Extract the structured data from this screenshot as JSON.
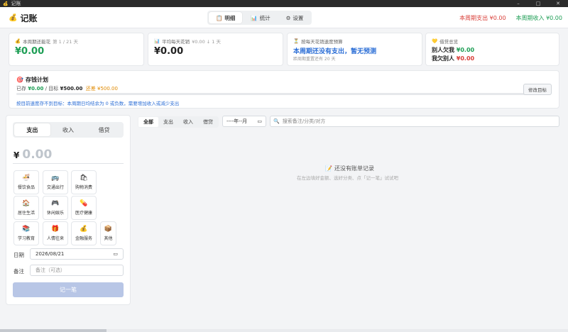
{
  "window": {
    "title": "记账",
    "minimize": "–",
    "maximize": "□",
    "close": "✕"
  },
  "app": {
    "icon": "💰",
    "title": "记账"
  },
  "nav": {
    "tabs": [
      {
        "icon": "📋",
        "label": "明细"
      },
      {
        "icon": "📊",
        "label": "统计"
      },
      {
        "icon": "⚙",
        "label": "设置"
      }
    ]
  },
  "period": {
    "expense": "本周期支出 ¥0.00",
    "income": "本周期收入 ¥0.00"
  },
  "stats": {
    "remaining": {
      "icon": "💰",
      "label": "本周期还能花",
      "sub": "第 1 / 21 天",
      "value": "¥0.00"
    },
    "daily": {
      "icon": "📊",
      "label": "平均每天花销",
      "sub": "¥0.00 ↓ 1 天",
      "value": "¥0.00"
    },
    "forecast": {
      "icon": "⏳",
      "label": "按每天花销速度预算",
      "value": "本周期还没有支出，暂无预测",
      "sub": "距周期重置还有 20 天"
    },
    "debt": {
      "icon": "💛",
      "label": "借贷总览",
      "owed_label": "别人欠我",
      "owed_value": "¥0.00",
      "owe_label": "我欠别人",
      "owe_value": "¥0.00"
    }
  },
  "plan": {
    "icon": "🎯",
    "title": "存钱计划",
    "saved_label": "已存",
    "saved_value": "¥0.00",
    "target_label": "/ 目标",
    "target_value": "¥500.00",
    "gap": "还差 ¥500.00",
    "progress": 0,
    "tip": "按目前速度存不到目标：本周期日均结余为 0 或负数，需要增加收入或减少支出",
    "edit_button": "修改目标"
  },
  "entry": {
    "types": [
      "支出",
      "收入",
      "借贷"
    ],
    "active_type": "支出",
    "currency": "¥",
    "amount": "0.00",
    "categories": [
      {
        "icon": "🍜",
        "label": "餐饮食品"
      },
      {
        "icon": "🚌",
        "label": "交通出行"
      },
      {
        "icon": "🛍",
        "label": "购物消费"
      },
      {
        "icon": "🏠",
        "label": "居住生活"
      },
      {
        "icon": "🎮",
        "label": "休闲娱乐"
      },
      {
        "icon": "💊",
        "label": "医疗健康"
      },
      {
        "icon": "📚",
        "label": "学习教育"
      },
      {
        "icon": "🎁",
        "label": "人情往来"
      },
      {
        "icon": "💰",
        "label": "金融服务"
      },
      {
        "icon": "📦",
        "label": "其他"
      }
    ],
    "date_label": "日期",
    "date_value": "2026/08/21",
    "note_label": "备注",
    "note_placeholder": "备注（可选）",
    "submit": "记一笔"
  },
  "list": {
    "filters": [
      "全部",
      "支出",
      "收入",
      "借贷"
    ],
    "active_filter": "全部",
    "month_placeholder": "----年--月",
    "search_placeholder": "搜索备注/分类/对方",
    "empty_icon": "📝",
    "empty_title": "还没有账单记录",
    "empty_sub": "在左边填好金额、选好分类、点「记一笔」试试吧"
  }
}
